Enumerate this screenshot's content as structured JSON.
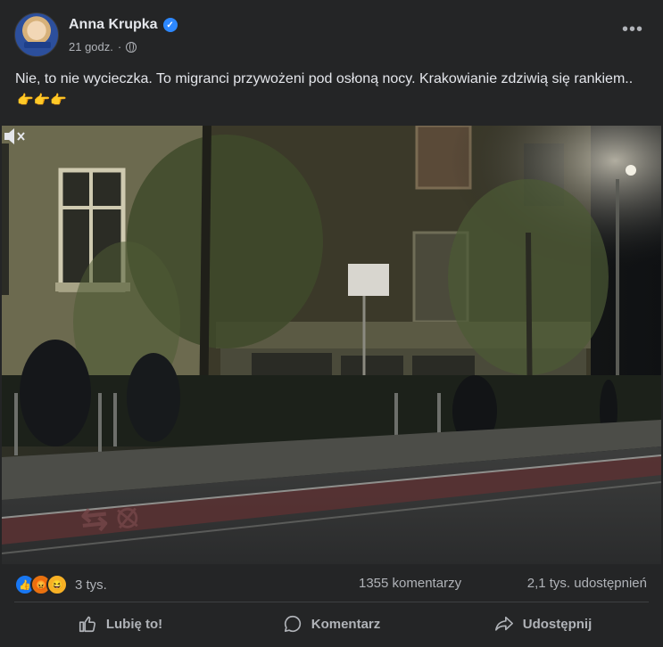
{
  "post": {
    "author": "Anna Krupka",
    "verified_icon": "verified-badge-icon",
    "time": "21 godz.",
    "separator": "·",
    "audience_icon": "globe-icon",
    "more_icon": "more-options-icon",
    "more_label": "•••",
    "text": "Nie, to nie wycieczka. To migranci przywożeni pod osłoną nocy. Krakowianie zdziwią się rankiem..",
    "emoji": "👉👉👉"
  },
  "video": {
    "mute_icon": "muted-speaker-icon"
  },
  "stats": {
    "reactions_count": "3 tys.",
    "reaction_icons": [
      "like-icon",
      "angry-icon",
      "haha-icon"
    ],
    "comments": "1355 komentarzy",
    "shares": "2,1 tys. udostępnień"
  },
  "actions": {
    "like_label": "Lubię to!",
    "comment_label": "Komentarz",
    "share_label": "Udostępnij"
  },
  "colors": {
    "background": "#242526",
    "text": "#e4e6eb",
    "secondary_text": "#b0b3b8",
    "accent": "#2d88ff"
  }
}
